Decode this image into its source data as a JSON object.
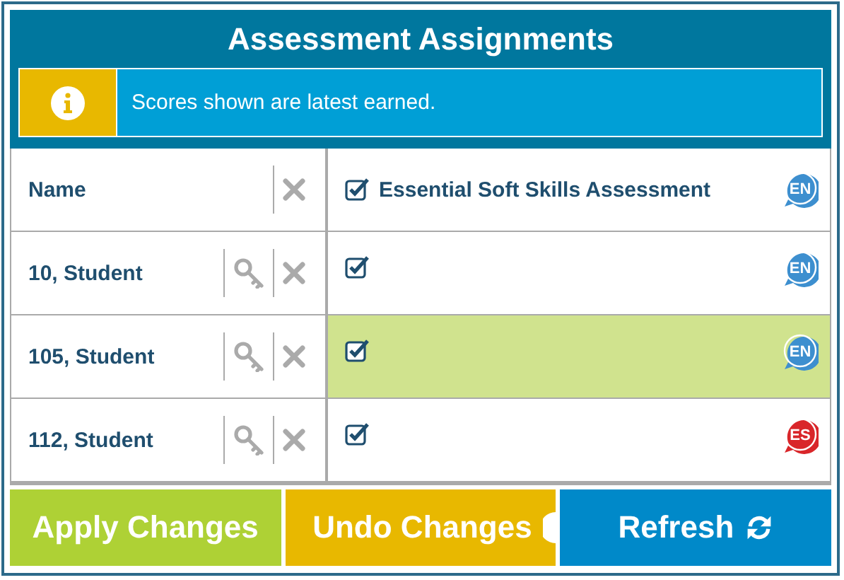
{
  "title": "Assessment Assignments",
  "info": {
    "message": "Scores shown are latest earned."
  },
  "table": {
    "name_header": "Name",
    "assessment": {
      "title": "Essential Soft Skills Assessment",
      "checked": true,
      "language": {
        "code": "EN",
        "color": "#3d8fcf"
      }
    },
    "rows": [
      {
        "name": "10, Student",
        "checked": true,
        "highlighted": false,
        "language": {
          "code": "EN",
          "color": "#3d8fcf"
        }
      },
      {
        "name": "105, Student",
        "checked": true,
        "highlighted": true,
        "language": {
          "code": "EN",
          "color": "#3d8fcf"
        }
      },
      {
        "name": "112, Student",
        "checked": true,
        "highlighted": false,
        "language": {
          "code": "ES",
          "color": "#d9262a"
        }
      }
    ]
  },
  "buttons": [
    {
      "label": "Apply Changes",
      "kind": "apply"
    },
    {
      "label": "Undo Changes",
      "kind": "undo"
    },
    {
      "label": "Refresh",
      "kind": "refresh"
    }
  ]
}
